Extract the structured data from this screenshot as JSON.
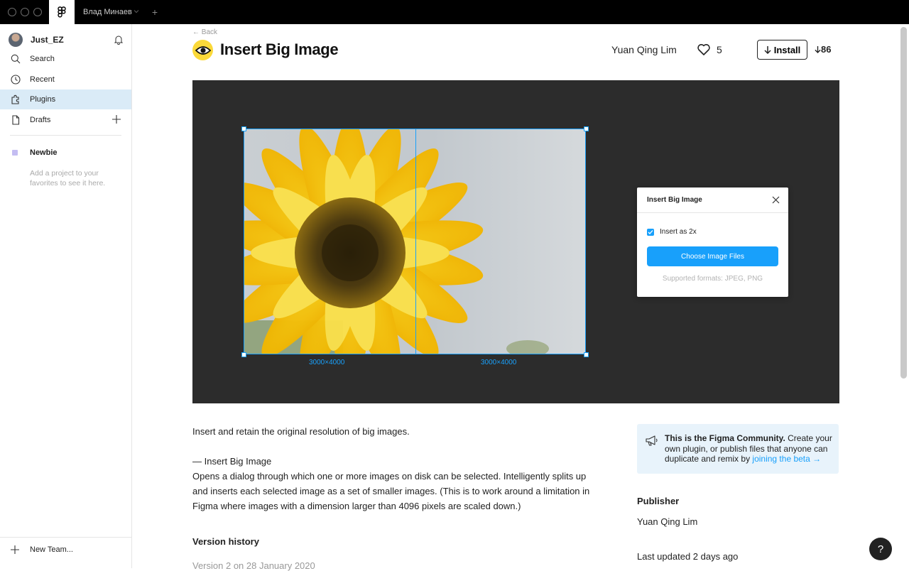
{
  "titlebar": {
    "tab_label": "Влад Минаев",
    "new_tab_symbol": "+"
  },
  "sidebar": {
    "user_name": "Just_EZ",
    "items": [
      {
        "label": "Search",
        "icon": "search-icon"
      },
      {
        "label": "Recent",
        "icon": "clock-icon"
      },
      {
        "label": "Plugins",
        "icon": "plugin-icon",
        "active": true
      },
      {
        "label": "Drafts",
        "icon": "file-icon"
      }
    ],
    "team_name": "Newbie",
    "team_color": "#c4bdf2",
    "favorites_hint": "Add a project to your favorites to see it here.",
    "new_team_label": "New Team..."
  },
  "plugin": {
    "back_label": "← Back",
    "title": "Insert Big Image",
    "author": "Yuan Qing Lim",
    "likes": "5",
    "install_label": "Install",
    "downloads": "86"
  },
  "hero": {
    "dim_left": "3000×4000",
    "dim_right": "3000×4000",
    "dialog": {
      "title": "Insert Big Image",
      "checkbox_label": "Insert as 2x",
      "checkbox_checked": true,
      "button_label": "Choose Image Files",
      "formats": "Supported formats: JPEG, PNG"
    }
  },
  "description": {
    "intro": "Insert and retain the original resolution of big images.",
    "command": "— Insert Big Image",
    "body": "Opens a dialog through which one or more images on disk can be selected. Intelligently splits up and inserts each selected image as a set of smaller images. (This is to work around a limitation in Figma where images with a dimension larger than 4096 pixels are scaled down.)",
    "version_heading": "Version history",
    "version_entry": "Version 2 on 28 January 2020"
  },
  "community": {
    "bold": "This is the Figma Community.",
    "text": " Create your own plugin, or publish files that anyone can duplicate and remix by ",
    "link": "joining the beta →"
  },
  "publisher": {
    "heading": "Publisher",
    "name": "Yuan Qing Lim",
    "updated": "Last updated 2 days ago"
  },
  "help_label": "?",
  "colors": {
    "accent": "#18a0fb",
    "active_nav": "#daebf7",
    "hero_bg": "#2c2c2c",
    "plugin_icon": "#fbd93a"
  }
}
